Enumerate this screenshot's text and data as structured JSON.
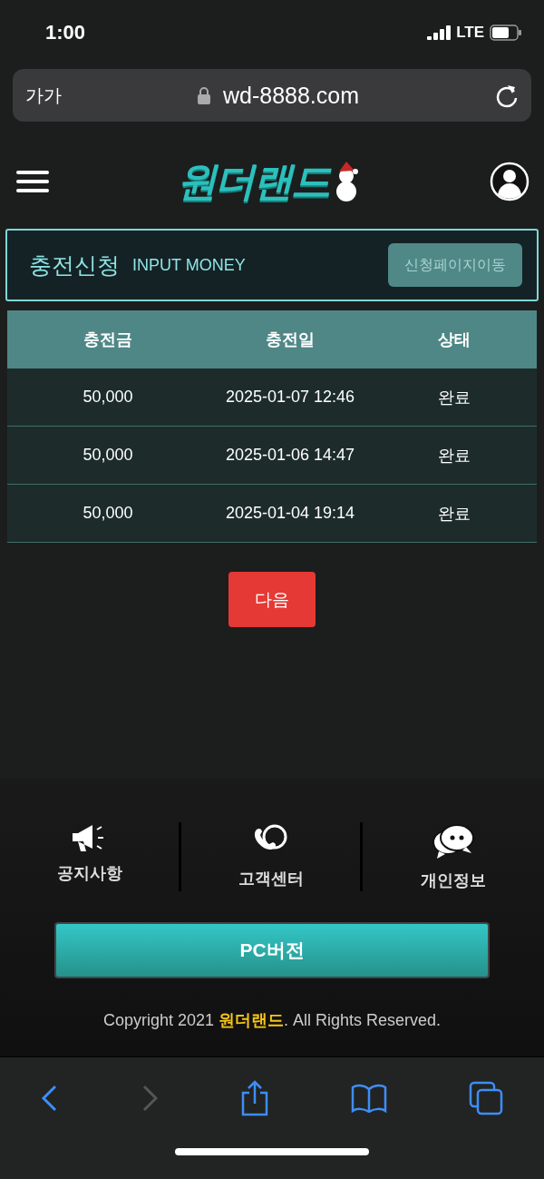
{
  "status_bar": {
    "time": "1:00",
    "network": "LTE"
  },
  "address_bar": {
    "text_size": "가가",
    "url": "wd-8888.com"
  },
  "header": {
    "logo": "원더랜드"
  },
  "panel": {
    "title": "충전신청",
    "subtitle": "INPUT MONEY",
    "button": "신청페이지이동"
  },
  "table": {
    "columns": [
      "충전금",
      "충전일",
      "상태"
    ],
    "rows": [
      [
        "50,000",
        "2025-01-07 12:46",
        "완료"
      ],
      [
        "50,000",
        "2025-01-06 14:47",
        "완료"
      ],
      [
        "50,000",
        "2025-01-04 19:14",
        "완료"
      ]
    ]
  },
  "next_button": "다음",
  "footer": {
    "links": [
      {
        "kind": "notice",
        "label": "공지사항"
      },
      {
        "kind": "support",
        "label": "고객센터"
      },
      {
        "kind": "privacy",
        "label": "개인정보"
      }
    ],
    "pc_button": "PC버전",
    "copyright": "Copyright 2021 **원더랜드**. All Rights Reserved."
  },
  "browser_toolbar": {
    "back_enabled": true,
    "forward_enabled": false
  }
}
